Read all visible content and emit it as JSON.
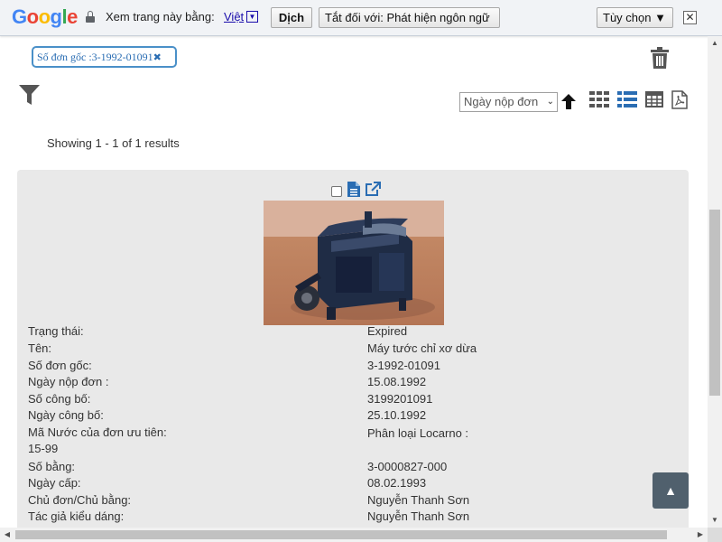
{
  "translate_bar": {
    "logo_letters": [
      "G",
      "o",
      "o",
      "g",
      "l",
      "e"
    ],
    "view_in_label": "Xem trang này bằng:",
    "language": "Việt",
    "language_arrow": "▼",
    "translate_button": "Dịch",
    "turn_off_button": "Tắt đối với: Phát hiện ngôn ngữ",
    "options_button": "Tùy chọn ▼",
    "close_glyph": "✕"
  },
  "filter_chip": {
    "text": "Số đơn gốc :3-1992-01091",
    "remove_glyph": "✖"
  },
  "toolbar": {
    "sort_value": "Ngày nộp đơn",
    "sort_caret": "⌄"
  },
  "results_text": "Showing 1 - 1 of 1 results",
  "record": {
    "fields": [
      {
        "label": "Trạng thái:",
        "value": "Expired"
      },
      {
        "label": "Tên:",
        "value": "Máy tước chỉ xơ dừa"
      },
      {
        "label": "Số đơn gốc:",
        "value": "3-1992-01091"
      },
      {
        "label": "Ngày nộp đơn :",
        "value": "15.08.1992"
      },
      {
        "label": "Số công bố:",
        "value": "3199201091"
      },
      {
        "label": "Ngày công bố:",
        "value": "25.10.1992"
      },
      {
        "label": "Mã Nước của đơn ưu tiên:",
        "value": "Phân loại Locarno :"
      },
      {
        "label": "15-99",
        "value": ""
      },
      {
        "label": "Số bằng:",
        "value": "3-0000827-000"
      },
      {
        "label": "Ngày cấp:",
        "value": "08.02.1993"
      },
      {
        "label": "Chủ đơn/Chủ bằng:",
        "value": "Nguyễn Thanh Sơn"
      },
      {
        "label": "Tác giả kiểu dáng:",
        "value": "Nguyễn Thanh Sơn"
      }
    ]
  },
  "back_to_top_glyph": "▲",
  "scroll_glyphs": {
    "up": "▲",
    "down": "▼",
    "left": "◀",
    "right": "▶"
  }
}
